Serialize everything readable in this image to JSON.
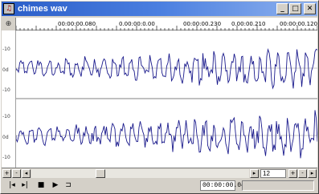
{
  "window": {
    "title": "chimes wav",
    "icon": "app-icon",
    "minimize_glyph": "_",
    "maximize_glyph": "□",
    "close_glyph": "✕"
  },
  "ruler": {
    "corner_icon": "zoom-fit-icon",
    "corner_glyph": "⊕",
    "ticks": [
      "00:00:00.080",
      "0.00:00:0.00",
      "00:00:00.230",
      "0.00:00.210",
      "00:00:00.120"
    ]
  },
  "channels": {
    "top_labels": [
      "-10",
      "0d",
      "-10"
    ],
    "bottom_labels": [
      "-10",
      "0d",
      "-10"
    ]
  },
  "scrollbar": {
    "zoom_in_glyph": "+",
    "zoom_out_glyph": "-",
    "left_arrow": "◂",
    "right_arrow": "▸",
    "zoom_value": "12",
    "zoom_in2_glyph": "+",
    "zoom_out2_glyph": "-",
    "page_glyph": "▸"
  },
  "transport": {
    "rewind_glyph": "|◂",
    "forward_glyph": "▸|",
    "stop_glyph": "■",
    "play_glyph": "▶",
    "loop_glyph": "⊐",
    "position": "00:00:00.04"
  },
  "colors": {
    "waveform": "#1a1a8c",
    "centerline": "#606060",
    "background": "#ffffff",
    "frame": "#d4d0c8"
  }
}
